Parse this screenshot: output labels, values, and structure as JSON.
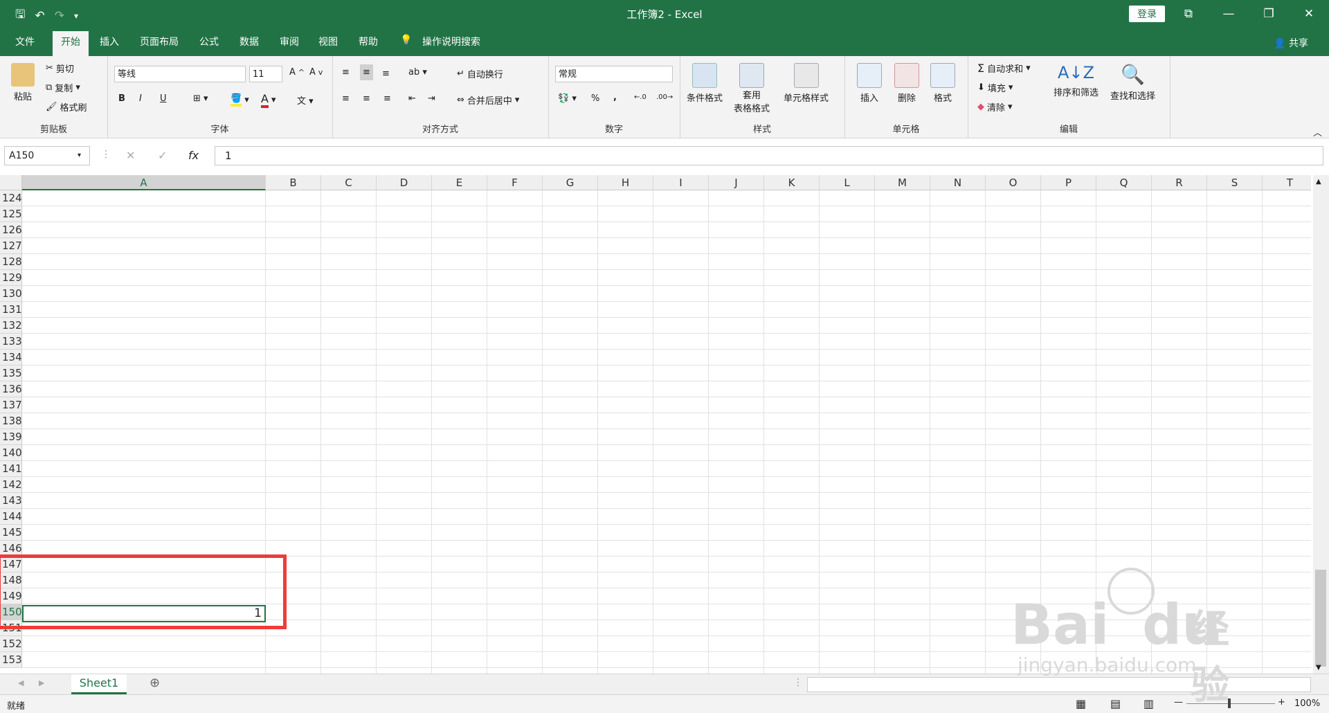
{
  "window": {
    "title": "工作簿2  -  Excel",
    "login_label": "登录",
    "share_label": "共享"
  },
  "menu": {
    "tabs": [
      "文件",
      "开始",
      "插入",
      "页面布局",
      "公式",
      "数据",
      "审阅",
      "视图",
      "帮助"
    ],
    "tell_me": "操作说明搜索"
  },
  "ribbon": {
    "clipboard": {
      "paste": "粘贴",
      "cut": "剪切",
      "copy": "复制",
      "format_painter": "格式刷",
      "label": "剪贴板"
    },
    "font": {
      "name": "等线",
      "size": "11",
      "bold": "B",
      "italic": "I",
      "underline": "U",
      "label": "字体"
    },
    "alignment": {
      "wrap": "自动换行",
      "merge": "合并后居中",
      "label": "对齐方式"
    },
    "number": {
      "format": "常规",
      "percent": "%",
      "comma": ",",
      "label": "数字"
    },
    "styles": {
      "conditional": "条件格式",
      "table_format_1": "套用",
      "table_format_2": "表格格式",
      "cell_styles": "单元格样式",
      "label": "样式"
    },
    "cells": {
      "insert": "插入",
      "delete": "删除",
      "format": "格式",
      "label": "单元格"
    },
    "editing": {
      "autosum": "自动求和",
      "fill": "填充",
      "clear": "清除",
      "sort": "排序和筛选",
      "find": "查找和选择",
      "label": "编辑"
    }
  },
  "formula_bar": {
    "name_box": "A150",
    "fx": "fx",
    "value": "1"
  },
  "grid": {
    "columns": [
      "A",
      "B",
      "C",
      "D",
      "E",
      "F",
      "G",
      "H",
      "I",
      "J",
      "K",
      "L",
      "M",
      "N",
      "O",
      "P",
      "Q",
      "R",
      "S",
      "T"
    ],
    "rows": [
      "124",
      "125",
      "126",
      "127",
      "128",
      "129",
      "130",
      "131",
      "132",
      "133",
      "134",
      "135",
      "136",
      "137",
      "138",
      "139",
      "140",
      "141",
      "142",
      "143",
      "144",
      "145",
      "146",
      "147",
      "148",
      "149",
      "150",
      "151",
      "152",
      "153"
    ],
    "selected_column": "A",
    "selected_row": "150",
    "active_cell_value": "1"
  },
  "sheets": {
    "tabs": [
      "Sheet1"
    ]
  },
  "status": {
    "ready": "就绪",
    "zoom": "100%"
  },
  "watermark": {
    "brand": "Bai",
    "brand2": "du",
    "cn": "经验",
    "url": "jingyan.baidu.com"
  },
  "colors": {
    "accent": "#217346",
    "highlight": "#ef3b3b"
  }
}
